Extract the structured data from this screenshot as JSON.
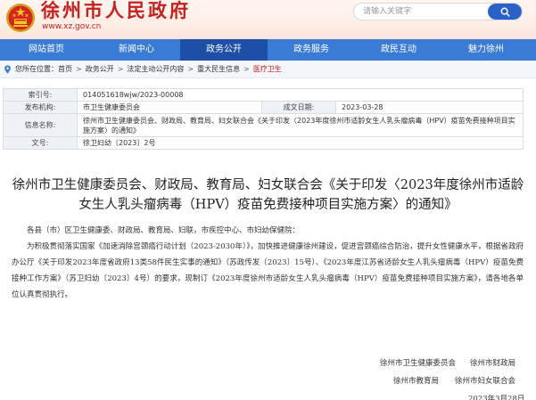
{
  "header": {
    "site_title": "徐州市人民政府",
    "site_domain": "www.xz.gov.cn",
    "search_placeholder": "请输入关键字"
  },
  "nav": {
    "items": [
      {
        "label": "网站首页"
      },
      {
        "label": "新闻中心"
      },
      {
        "label": "政务公开",
        "active": true
      },
      {
        "label": "政务服务"
      },
      {
        "label": "政民互动"
      },
      {
        "label": "魅力徐州"
      }
    ]
  },
  "breadcrumb": {
    "prefix": "您所在位置：",
    "items": [
      "首页",
      "政务公开",
      "法定主动公开内容",
      "重大民生信息",
      "医疗卫生"
    ]
  },
  "info": {
    "index_label": "索引号:",
    "index_value": "014051618wjw/2023-00008",
    "publisher_label": "发布机构:",
    "publisher_value": "市卫生健康委员会",
    "date_label": "成文日期:",
    "date_value": "2023-03-28",
    "name_label": "信息名称:",
    "name_value": "徐州市卫生健康委员会、财政局、教育局、妇女联合会《关于印发〈2023年度徐州市适龄女生人乳头瘤病毒（HPV）疫苗免费接种项目实施方案〉的通知》",
    "docno_label": "文号:",
    "docno_value": "徐卫妇幼〔2023〕2号"
  },
  "document": {
    "title": "徐州市卫生健康委员会、财政局、教育局、妇女联合会《关于印发〈2023年度徐州市适龄女生人乳头瘤病毒（HPV）疫苗免费接种项目实施方案〉的通知》",
    "salutation": "各县（市）区卫生健康委、财政局、教育局、妇联，市疾控中心、市妇幼保健院：",
    "paragraph": "为积极贯彻落实国家《加速消除宫颈癌行动计划（2023-2030年）》，加快推进健康徐州建设，促进宫颈癌综合防治，提升女性健康水平，根据省政府办公厅《关于印发2023年度省政府13类58件民生实事的通知》（苏政传发〔2023〕15号）、《2023年度江苏省适龄女生人乳头瘤病毒（HPV）疫苗免费接种工作方案》（苏卫妇幼〔2023〕4号）的要求，现制订《2023年度徐州市适龄女生人乳头瘤病毒（HPV）疫苗免费接种项目实施方案》，请各地各单位认真贯彻执行。",
    "signatures": {
      "sig1": "徐州市卫生健康委员会",
      "sig2": "徐州市财政局",
      "sig3": "徐州市教育局",
      "sig4": "徐州市妇女联合会",
      "date": "2023年3月28日"
    }
  },
  "colors": {
    "brand_red": "#c8201f",
    "nav_blue": "#3a7bd5",
    "nav_active": "#1d4fa7",
    "search_blue": "#2a61c9"
  }
}
